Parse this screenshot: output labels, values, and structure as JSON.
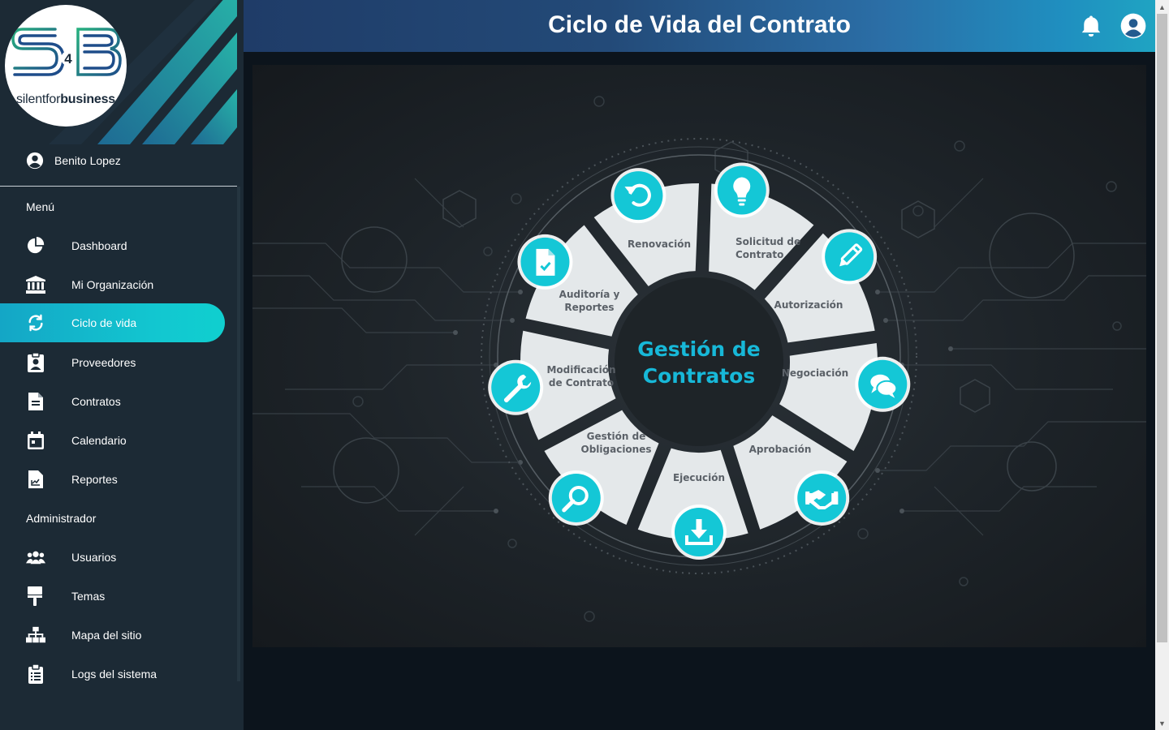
{
  "brand": {
    "logo_top": "S4B",
    "logo_text_a": "silent",
    "logo_text_b": "for",
    "logo_text_c": "business"
  },
  "user": {
    "name": "Benito Lopez"
  },
  "sidebar": {
    "menu_label": "Menú",
    "admin_label": "Administrador",
    "items": [
      {
        "label": "Dashboard",
        "icon": "pie-chart-icon"
      },
      {
        "label": "Mi Organización",
        "icon": "institution-icon"
      },
      {
        "label": "Ciclo de vida",
        "icon": "sync-icon",
        "active": true
      },
      {
        "label": "Proveedores",
        "icon": "id-badge-icon"
      },
      {
        "label": "Contratos",
        "icon": "document-icon"
      },
      {
        "label": "Calendario",
        "icon": "calendar-icon"
      },
      {
        "label": "Reportes",
        "icon": "report-icon"
      }
    ],
    "admin_items": [
      {
        "label": "Usuarios",
        "icon": "users-icon"
      },
      {
        "label": "Temas",
        "icon": "paint-roller-icon"
      },
      {
        "label": "Mapa del sitio",
        "icon": "sitemap-icon"
      },
      {
        "label": "Logs del sistema",
        "icon": "clipboard-list-icon"
      }
    ]
  },
  "header": {
    "title": "Ciclo de Vida del Contrato"
  },
  "wheel": {
    "center_line1": "Gestión de",
    "center_line2": "Contratos",
    "stages": [
      {
        "line1": "Solicitud de",
        "line2": "Contrato",
        "icon": "lightbulb-icon"
      },
      {
        "line1": "Autorización",
        "line2": "",
        "icon": "pencil-icon"
      },
      {
        "line1": "Negociación",
        "line2": "",
        "icon": "chat-bubbles-icon"
      },
      {
        "line1": "Aprobación",
        "line2": "",
        "icon": "handshake-icon"
      },
      {
        "line1": "Ejecución",
        "line2": "",
        "icon": "download-icon"
      },
      {
        "line1": "Gestión de",
        "line2": "Obligaciones",
        "icon": "magnifier-icon"
      },
      {
        "line1": "Modificación",
        "line2": "de Contrato",
        "icon": "wrench-icon"
      },
      {
        "line1": "Auditoría y",
        "line2": "Reportes",
        "icon": "file-check-icon"
      },
      {
        "line1": "Renovación",
        "line2": "",
        "icon": "undo-icon"
      }
    ]
  },
  "colors": {
    "sidebar_bg": "#1c2a35",
    "accent": "#12c7d0",
    "header_start": "#1f3c68",
    "header_end": "#1fa4c2",
    "wheel_segment": "#e4e8ea",
    "wheel_center": "#1e2428"
  }
}
